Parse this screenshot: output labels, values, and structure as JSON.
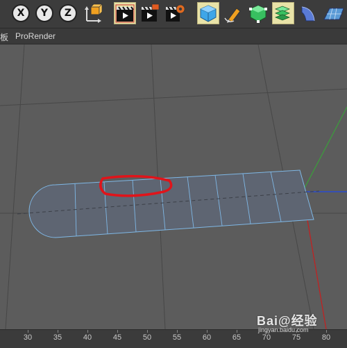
{
  "toolbar": {
    "axes": [
      "X",
      "Y",
      "Z"
    ]
  },
  "menubar": {
    "left_fragment": "板",
    "prorender": "ProRender"
  },
  "ruler": {
    "ticks": [
      "30",
      "35",
      "40",
      "45",
      "50",
      "55",
      "60",
      "65",
      "70",
      "75",
      "80"
    ]
  },
  "watermark": {
    "brand": "Bai@经验",
    "url": "jingyan.baidu.com"
  },
  "colors": {
    "toolbar_bg": "#3c3c3c",
    "viewport_bg": "#5c5c5c",
    "mesh_fill": "#5e6572",
    "mesh_edge": "#7fb8e6",
    "annotation": "#e0141a",
    "axis_x": "#c81e1e",
    "axis_y": "#3aa03a",
    "axis_z": "#2a4bd0"
  }
}
